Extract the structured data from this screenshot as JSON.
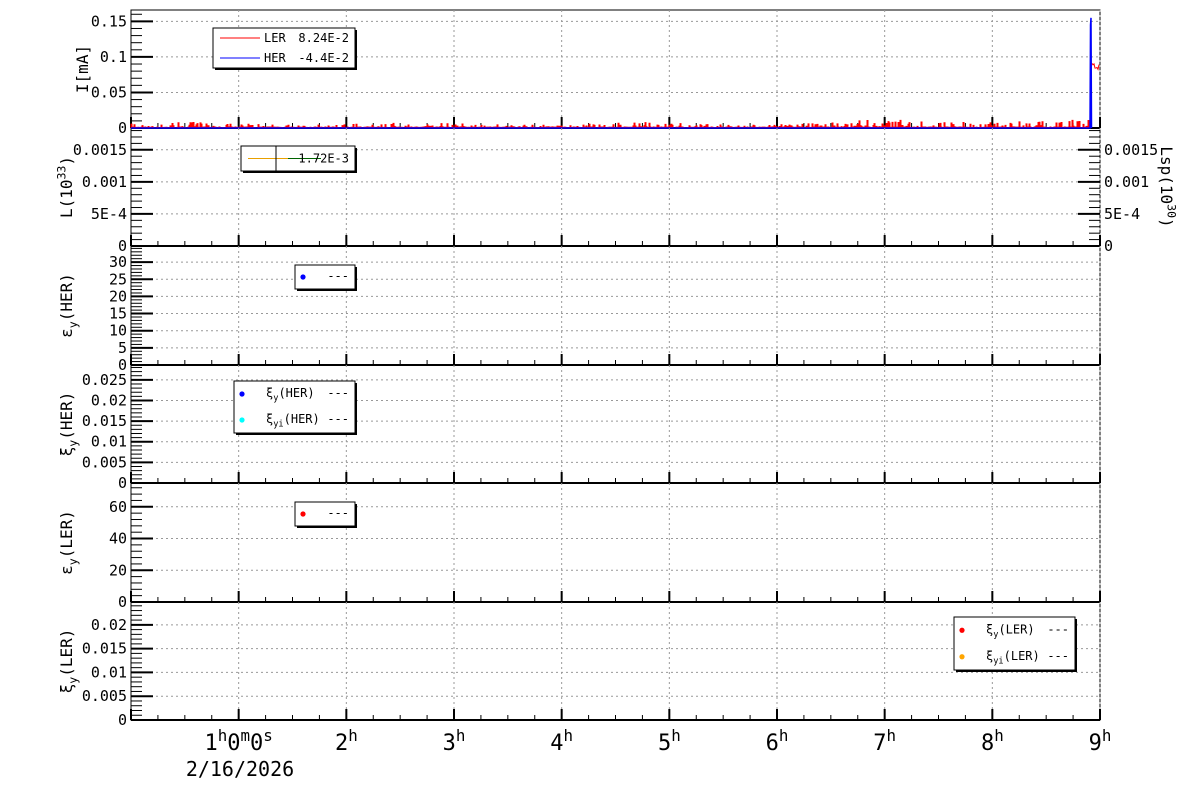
{
  "chart_data": {
    "type": "line",
    "x_unit": "hours",
    "xlim": [
      0,
      9
    ],
    "x_ticks": [
      {
        "value": 1,
        "label": "1^{h}0^{m}0^{s}"
      },
      {
        "value": 2,
        "label": "2^{h}"
      },
      {
        "value": 3,
        "label": "3^{h}"
      },
      {
        "value": 4,
        "label": "4^{h}"
      },
      {
        "value": 5,
        "label": "5^{h}"
      },
      {
        "value": 6,
        "label": "6^{h}"
      },
      {
        "value": 7,
        "label": "7^{h}"
      },
      {
        "value": 8,
        "label": "8^{h}"
      },
      {
        "value": 9,
        "label": "9^{h}"
      }
    ],
    "date_label": "2/16/2026",
    "grid": true,
    "panels": [
      {
        "ylabel": "I[mA]",
        "ylim": [
          0,
          0.166
        ],
        "ticks": [
          {
            "v": 0,
            "l": "0"
          },
          {
            "v": 0.05,
            "l": "0.05"
          },
          {
            "v": 0.1,
            "l": "0.1"
          },
          {
            "v": 0.15,
            "l": "0.15"
          }
        ],
        "legend": [
          {
            "name": "LER",
            "value": "8.24E-2",
            "color": "#ff0000",
            "kind": "line"
          },
          {
            "name": "HER",
            "value": "-4.4E-2",
            "color": "#0000ff",
            "kind": "line"
          }
        ],
        "series": [
          {
            "name": "LER",
            "color": "#ff0000",
            "description": "noise 0-0.012 until 8.92h, then ~0.085",
            "points": [
              [
                0,
                0.002
              ],
              [
                2.5,
                0.008
              ],
              [
                5.3,
                0.01
              ],
              [
                7,
                0.012
              ],
              [
                8.5,
                0.01
              ],
              [
                8.92,
                0.003
              ],
              [
                8.93,
                0.085
              ],
              [
                9,
                0.088
              ]
            ]
          },
          {
            "name": "HER",
            "color": "#0000ff",
            "points": [
              [
                0,
                0
              ],
              [
                8.9,
                0
              ],
              [
                8.91,
                0.145
              ],
              [
                8.92,
                0.155
              ],
              [
                8.93,
                0
              ]
            ]
          }
        ]
      },
      {
        "ylabel": "L(10^{33})",
        "ylim": [
          0,
          0.00184
        ],
        "ticks": [
          {
            "v": 0,
            "l": "0"
          },
          {
            "v": 0.0005,
            "l": "5E-4"
          },
          {
            "v": 0.001,
            "l": "0.001"
          },
          {
            "v": 0.0015,
            "l": "0.0015"
          }
        ],
        "right_ylabel": "Lsp(10^{30})",
        "right_ticks": [
          {
            "v": 0,
            "l": "0"
          },
          {
            "v": 0.0005,
            "l": "5E-4"
          },
          {
            "v": 0.001,
            "l": "0.001"
          },
          {
            "v": 0.0015,
            "l": "0.0015"
          }
        ],
        "legend": [
          {
            "name": "",
            "value": "1.72E-3",
            "color": "#e8a000",
            "color2": "#006400",
            "kind": "dualline"
          }
        ],
        "series": []
      },
      {
        "ylabel": "ε_{y}(HER)",
        "ylim": [
          0,
          34.7
        ],
        "ticks": [
          {
            "v": 0,
            "l": "0"
          },
          {
            "v": 5,
            "l": "5"
          },
          {
            "v": 10,
            "l": "10"
          },
          {
            "v": 15,
            "l": "15"
          },
          {
            "v": 20,
            "l": "20"
          },
          {
            "v": 25,
            "l": "25"
          },
          {
            "v": 30,
            "l": "30"
          }
        ],
        "legend": [
          {
            "name": "",
            "value": "---",
            "color": "#0000ff",
            "kind": "dot"
          }
        ],
        "series": []
      },
      {
        "ylabel": "ξ_{y}(HER)",
        "ylim": [
          0,
          0.0286
        ],
        "ticks": [
          {
            "v": 0,
            "l": "0"
          },
          {
            "v": 0.005,
            "l": "0.005"
          },
          {
            "v": 0.01,
            "l": "0.01"
          },
          {
            "v": 0.015,
            "l": "0.015"
          },
          {
            "v": 0.02,
            "l": "0.02"
          },
          {
            "v": 0.025,
            "l": "0.025"
          }
        ],
        "legend": [
          {
            "name": "ξ_{y}(HER)",
            "value": "---",
            "color": "#0000ff",
            "kind": "dot"
          },
          {
            "name": "ξ_{yi}(HER)",
            "value": "---",
            "color": "#00ffff",
            "kind": "dot"
          }
        ],
        "series": []
      },
      {
        "ylabel": "ε_{y}(LER)",
        "ylim": [
          0,
          75
        ],
        "ticks": [
          {
            "v": 0,
            "l": "0"
          },
          {
            "v": 20,
            "l": "20"
          },
          {
            "v": 40,
            "l": "40"
          },
          {
            "v": 60,
            "l": "60"
          }
        ],
        "legend": [
          {
            "name": "",
            "value": "---",
            "color": "#ff0000",
            "kind": "dot"
          }
        ],
        "series": []
      },
      {
        "ylabel": "ξ_{y}(LER)",
        "ylim": [
          0,
          0.0248
        ],
        "ticks": [
          {
            "v": 0,
            "l": "0"
          },
          {
            "v": 0.005,
            "l": "0.005"
          },
          {
            "v": 0.01,
            "l": "0.01"
          },
          {
            "v": 0.015,
            "l": "0.015"
          },
          {
            "v": 0.02,
            "l": "0.02"
          }
        ],
        "legend": [
          {
            "name": "ξ_{y}(LER)",
            "value": "---",
            "color": "#ff0000",
            "kind": "dot"
          },
          {
            "name": "ξ_{yi}(LER)",
            "value": "---",
            "color": "#ffa500",
            "kind": "dot"
          }
        ],
        "series": []
      }
    ]
  }
}
